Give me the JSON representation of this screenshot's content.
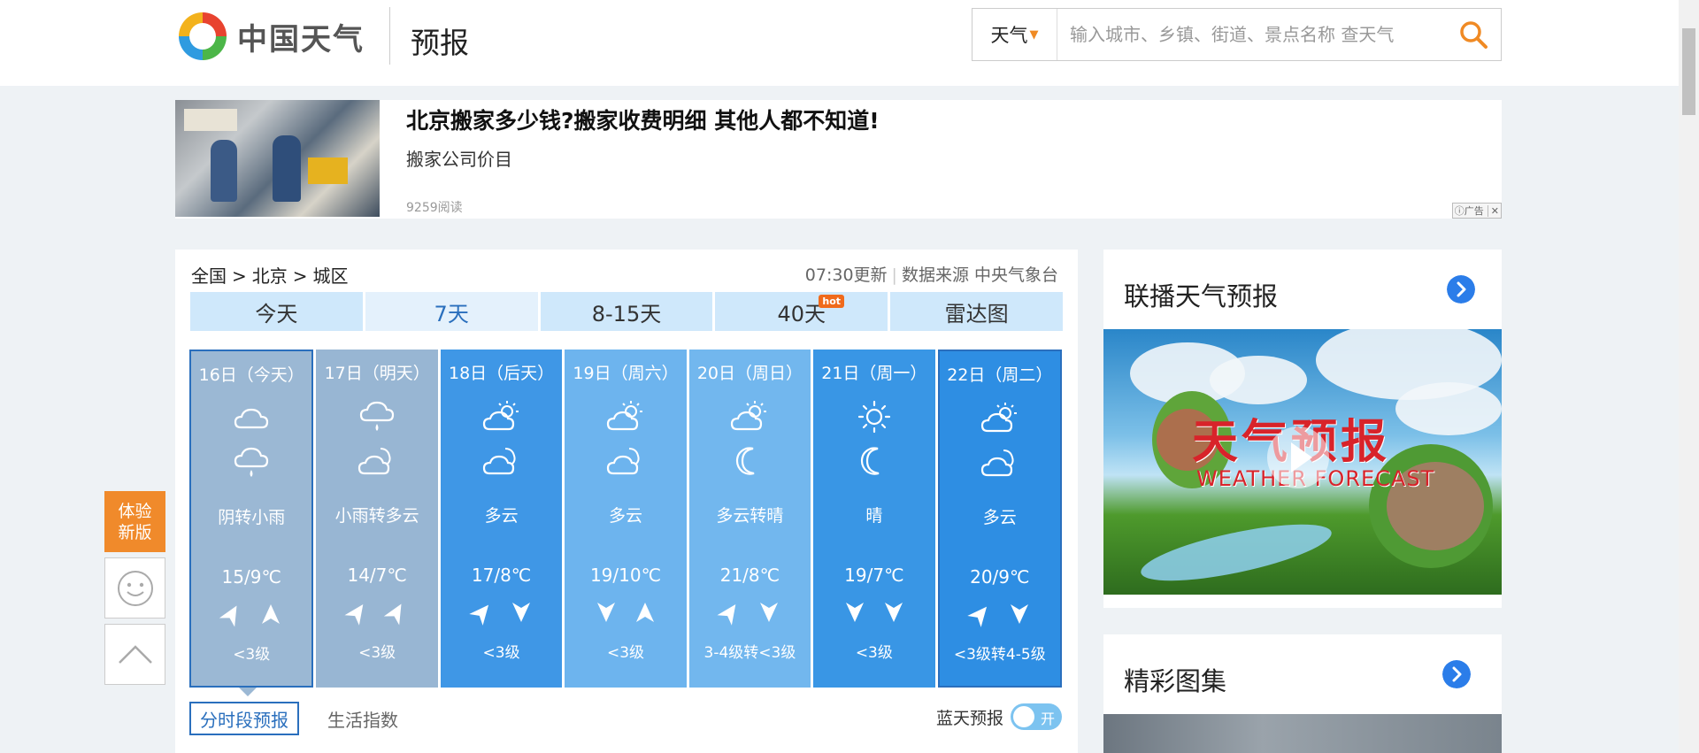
{
  "header": {
    "logo_text": "中国天气",
    "section_title": "预报",
    "search": {
      "type_label": "天气",
      "placeholder": "输入城市、乡镇、街道、景点名称 查天气"
    }
  },
  "ad": {
    "title": "北京搬家多少钱?搬家收费明细 其他人都不知道!",
    "subtitle": "搬家公司价目",
    "reads": "9259阅读",
    "badge": "广告"
  },
  "breadcrumb": {
    "level1": "全国",
    "level2": "北京",
    "level3": "城区",
    "separator": ">"
  },
  "update_info": {
    "time": "07:30更新",
    "source": "数据来源 中央气象台"
  },
  "tabs": [
    {
      "label": "今天"
    },
    {
      "label": "7天"
    },
    {
      "label": "8-15天"
    },
    {
      "label": "40天",
      "badge": "hot"
    },
    {
      "label": "雷达图"
    }
  ],
  "days": [
    {
      "date": "16日（今天）",
      "icon_day": "cloudy-icon",
      "icon_night": "light-rain-icon",
      "desc": "阴转小雨",
      "temp": "15/9℃",
      "level": "<3级",
      "bg": "#9bb8d4"
    },
    {
      "date": "17日（明天）",
      "icon_day": "light-rain-icon",
      "icon_night": "partly-cloudy-night-icon",
      "desc": "小雨转多云",
      "temp": "14/7℃",
      "level": "<3级",
      "bg": "#98b6d3"
    },
    {
      "date": "18日（后天）",
      "icon_day": "partly-cloudy-icon",
      "icon_night": "partly-cloudy-night-icon",
      "desc": "多云",
      "temp": "17/8℃",
      "level": "<3级",
      "bg": "#3f97e6"
    },
    {
      "date": "19日（周六）",
      "icon_day": "partly-cloudy-icon",
      "icon_night": "partly-cloudy-night-icon",
      "desc": "多云",
      "temp": "19/10℃",
      "level": "<3级",
      "bg": "#6db4ee"
    },
    {
      "date": "20日（周日）",
      "icon_day": "partly-cloudy-icon",
      "icon_night": "clear-night-icon",
      "desc": "多云转晴",
      "temp": "21/8℃",
      "level": "3-4级转<3级",
      "bg": "#72b7ee"
    },
    {
      "date": "21日（周一）",
      "icon_day": "sunny-icon",
      "icon_night": "clear-night-icon",
      "desc": "晴",
      "temp": "19/7℃",
      "level": "<3级",
      "bg": "#3996e5"
    },
    {
      "date": "22日（周二）",
      "icon_day": "partly-cloudy-icon",
      "icon_night": "partly-cloudy-night-icon",
      "desc": "多云",
      "temp": "20/9℃",
      "level": "<3级转4-5级",
      "bg": "#2e8ee3"
    }
  ],
  "subtabs": [
    {
      "label": "分时段预报"
    },
    {
      "label": "生活指数"
    }
  ],
  "bluesky": {
    "label": "蓝天预报",
    "toggle_text": "开"
  },
  "side": {
    "broadcast_title": "联播天气预报",
    "video_title": "天气预报",
    "video_sub": "WEATHER FORECAST",
    "gallery_title": "精彩图集"
  },
  "float": {
    "new_version": "体验新版"
  }
}
